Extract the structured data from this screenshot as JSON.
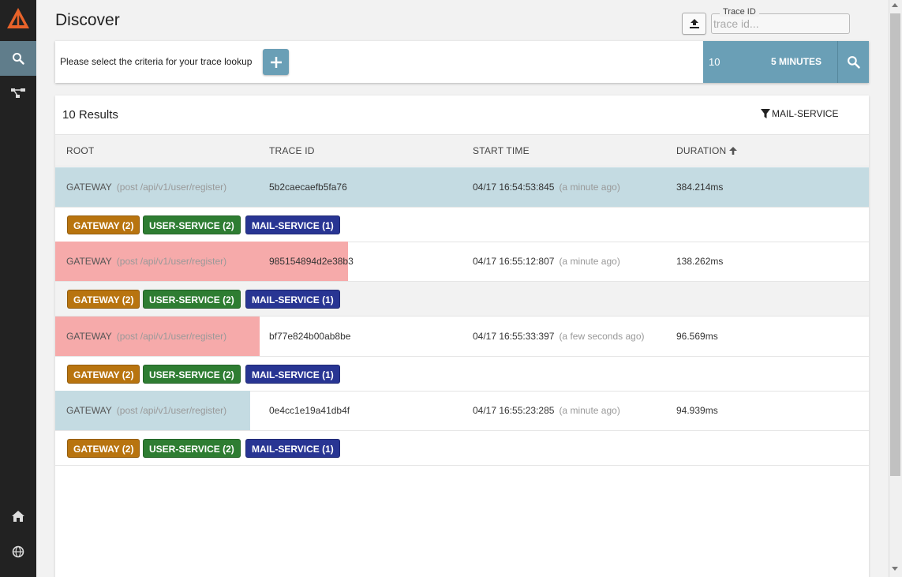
{
  "page": {
    "title": "Discover"
  },
  "header": {
    "trace_id_label": "Trace ID",
    "trace_id_placeholder": "trace id..."
  },
  "criteria": {
    "hint": "Please select the criteria for your trace lookup",
    "limit": "10",
    "time_range": "5 MINUTES"
  },
  "results": {
    "count_label": "10 Results",
    "filter": "MAIL-SERVICE",
    "columns": [
      "ROOT",
      "TRACE ID",
      "START TIME",
      "DURATION"
    ],
    "rows": [
      {
        "service": "GATEWAY",
        "endpoint": "(post /api/v1/user/register)",
        "trace_id": "5b2caecaefb5fa76",
        "start": "04/17 16:54:53:845",
        "ago": "(a minute ago)",
        "duration": "384.214ms",
        "duration_fraction": 1.0,
        "status": "ok",
        "tags": [
          "GATEWAY (2)",
          "USER-SERVICE (2)",
          "MAIL-SERVICE (1)"
        ]
      },
      {
        "service": "GATEWAY",
        "endpoint": "(post /api/v1/user/register)",
        "trace_id": "985154894d2e38b3",
        "start": "04/17 16:55:12:807",
        "ago": "(a minute ago)",
        "duration": "138.262ms",
        "duration_fraction": 0.36,
        "status": "error",
        "tags": [
          "GATEWAY (2)",
          "USER-SERVICE (2)",
          "MAIL-SERVICE (1)"
        ]
      },
      {
        "service": "GATEWAY",
        "endpoint": "(post /api/v1/user/register)",
        "trace_id": "bf77e824b00ab8be",
        "start": "04/17 16:55:33:397",
        "ago": "(a few seconds ago)",
        "duration": "96.569ms",
        "duration_fraction": 0.251,
        "status": "error",
        "tags": [
          "GATEWAY (2)",
          "USER-SERVICE (2)",
          "MAIL-SERVICE (1)"
        ]
      },
      {
        "service": "GATEWAY",
        "endpoint": "(post /api/v1/user/register)",
        "trace_id": "0e4cc1e19a41db4f",
        "start": "04/17 16:55:23:285",
        "ago": "(a minute ago)",
        "duration": "94.939ms",
        "duration_fraction": 0.24,
        "status": "ok",
        "tags": [
          "GATEWAY (2)",
          "USER-SERVICE (2)",
          "MAIL-SERVICE (1)"
        ]
      }
    ]
  },
  "colors": {
    "sidebar": "#222222",
    "accent": "#6a9fb6",
    "ok_bar": "#c4dbe2",
    "error_bar": "#f6aaaa",
    "gateway_tag": "#b8740f",
    "user_service_tag": "#2e7d32",
    "mail_service_tag": "#283593"
  },
  "icons": {
    "logo": "brand-logo-icon",
    "nav": [
      "search-icon",
      "dependencies-icon",
      "home-icon",
      "globe-icon"
    ],
    "upload": "upload-icon",
    "add": "plus-icon",
    "search": "search-icon",
    "filter": "filter-icon",
    "sort": "arrow-up-icon"
  }
}
